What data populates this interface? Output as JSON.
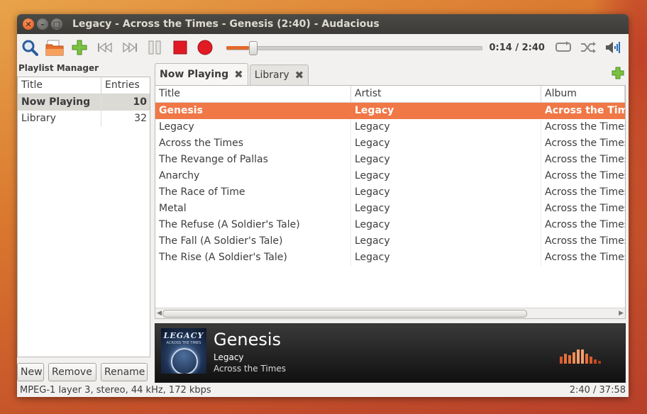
{
  "window": {
    "title": "Legacy - Across the Times - Genesis (2:40) - Audacious"
  },
  "toolbar": {
    "search_icon": "search-icon",
    "open_icon": "folder-open-icon",
    "add_icon": "add-icon",
    "time": "0:14 / 2:40",
    "seek_progress": 0.0875
  },
  "sidebar": {
    "title": "Playlist Manager",
    "col_title": "Title",
    "col_entries": "Entries",
    "playlists": [
      {
        "name": "Now Playing",
        "entries": "10"
      },
      {
        "name": "Library",
        "entries": "32"
      }
    ],
    "new_label": "New",
    "remove_label": "Remove",
    "rename_label": "Rename"
  },
  "tabs": [
    {
      "label": "Now Playing"
    },
    {
      "label": "Library"
    }
  ],
  "tracklist": {
    "columns": {
      "title": "Title",
      "artist": "Artist",
      "album": "Album"
    },
    "rows": [
      {
        "title": "Genesis",
        "artist": "Legacy",
        "album": "Across the Times"
      },
      {
        "title": "Legacy",
        "artist": "Legacy",
        "album": "Across the Times"
      },
      {
        "title": "Across the Times",
        "artist": "Legacy",
        "album": "Across the Times"
      },
      {
        "title": "The Revange of Pallas",
        "artist": "Legacy",
        "album": "Across the Times"
      },
      {
        "title": "Anarchy",
        "artist": "Legacy",
        "album": "Across the Times"
      },
      {
        "title": "The Race of Time",
        "artist": "Legacy",
        "album": "Across the Times"
      },
      {
        "title": "Metal",
        "artist": "Legacy",
        "album": "Across the Times"
      },
      {
        "title": "The Refuse (A Soldier's Tale)",
        "artist": "Legacy",
        "album": "Across the Times"
      },
      {
        "title": "The Fall (A Soldier's Tale)",
        "artist": "Legacy",
        "album": "Across the Times"
      },
      {
        "title": "The Rise (A Soldier's Tale)",
        "artist": "Legacy",
        "album": "Across the Times"
      }
    ]
  },
  "now_playing": {
    "art_brand": "LEGACY",
    "art_subtitle": "ACROSS THE TIMES",
    "title": "Genesis",
    "artist": "Legacy",
    "album": "Across the Times"
  },
  "status": {
    "format": "MPEG-1 layer 3, stereo, 44 kHz, 172 kbps",
    "length": "2:40 / 37:58"
  },
  "colors": {
    "accent": "#f07746",
    "record": "#e01b24",
    "titlebar": "#3c3b37"
  }
}
